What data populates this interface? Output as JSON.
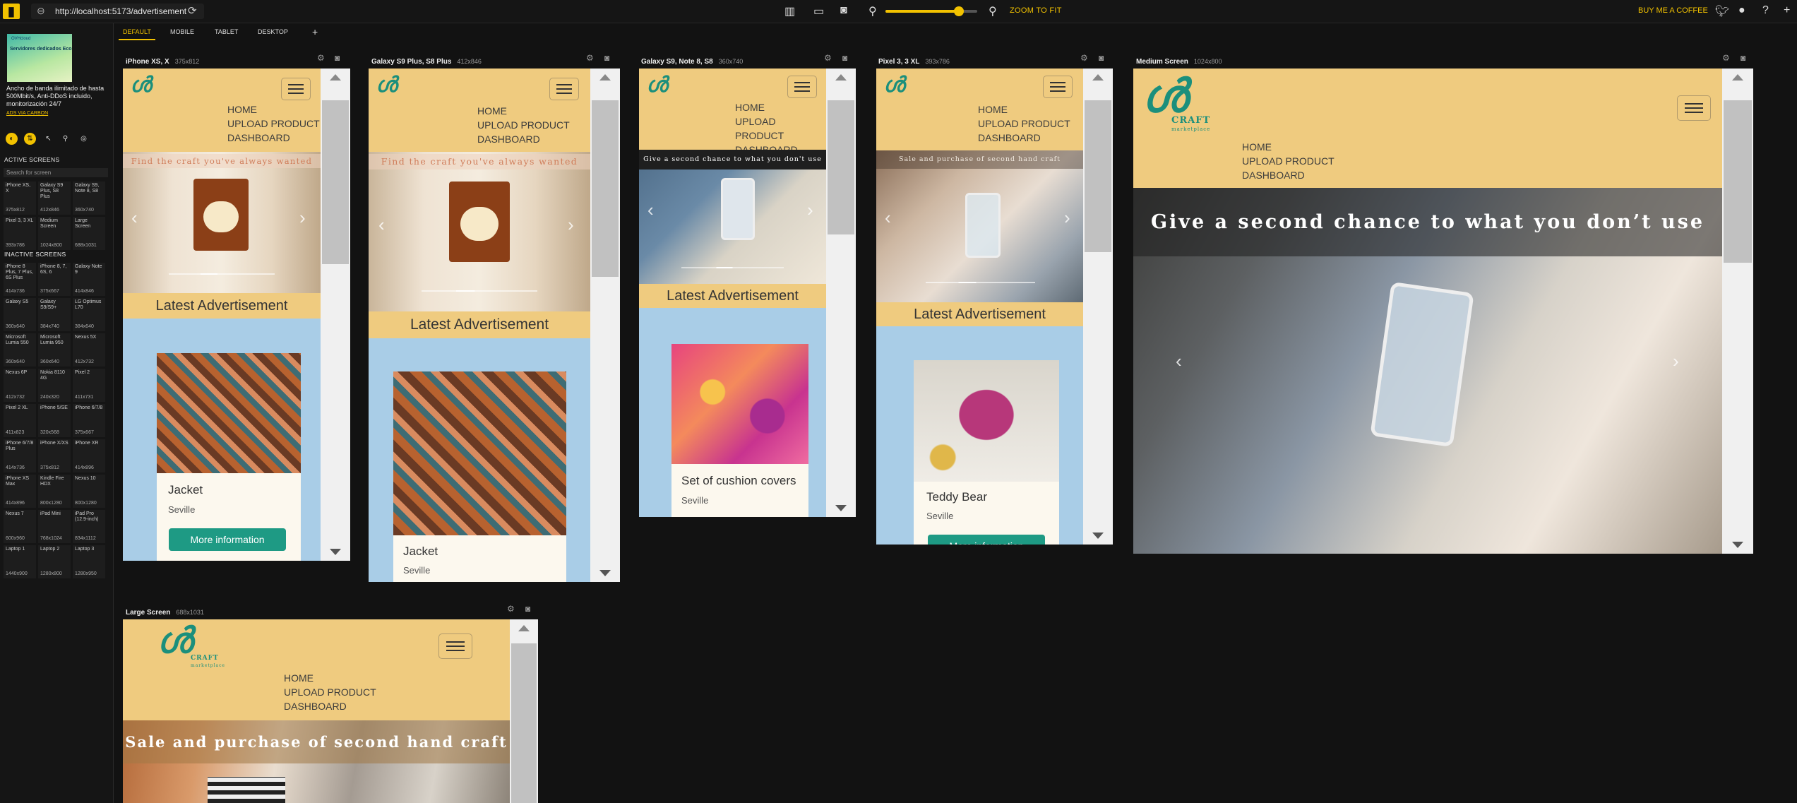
{
  "toolbar": {
    "url": "http://localhost:5173/advertisement",
    "zoom_level": 0.4,
    "zoom_to_fit": "ZOOM TO FIT",
    "buy_coffee": "BUY ME A COFFEE"
  },
  "tabs": [
    "DEFAULT",
    "MOBILE",
    "TABLET",
    "DESKTOP"
  ],
  "sidebar": {
    "ad_image_line1": "OVHcloud",
    "ad_image_line2": "Servidores dedicados Eco",
    "ad_text": "Ancho de banda ilimitado de hasta 500Mbit/s, Anti-DDoS incluido, monitorización 24/7",
    "ad_link": "ADS VIA CARBON",
    "active_heading": "ACTIVE SCREENS",
    "search_placeholder": "Search for screen",
    "inactive_heading": "INACTIVE SCREENS",
    "active_screens": [
      {
        "name": "iPhone XS, X",
        "size": "375x812"
      },
      {
        "name": "Galaxy S9 Plus, S8 Plus",
        "size": "412x846"
      },
      {
        "name": "Galaxy S9, Note 8, S8",
        "size": "360x740"
      },
      {
        "name": "Pixel 3, 3 XL",
        "size": "393x786"
      },
      {
        "name": "Medium Screen",
        "size": "1024x800"
      },
      {
        "name": "Large Screen",
        "size": "688x1031"
      }
    ],
    "inactive_screens": [
      {
        "name": "iPhone 8 Plus, 7 Plus, 6S Plus",
        "size": "414x736"
      },
      {
        "name": "iPhone 8, 7, 6S, 6",
        "size": "375x667"
      },
      {
        "name": "Galaxy Note 9",
        "size": "414x846"
      },
      {
        "name": "Galaxy S5",
        "size": "360x640"
      },
      {
        "name": "Galaxy S9/S9+",
        "size": "384x740"
      },
      {
        "name": "LG Optimus L70",
        "size": "384x640"
      },
      {
        "name": "Microsoft Lumia 550",
        "size": "360x640"
      },
      {
        "name": "Microsoft Lumia 950",
        "size": "360x640"
      },
      {
        "name": "Nexus 5X",
        "size": "412x732"
      },
      {
        "name": "Nexus 6P",
        "size": "412x732"
      },
      {
        "name": "Nokia 8110 4G",
        "size": "240x320"
      },
      {
        "name": "Pixel 2",
        "size": "411x731"
      },
      {
        "name": "Pixel 2 XL",
        "size": "411x823"
      },
      {
        "name": "iPhone 5/SE",
        "size": "320x568"
      },
      {
        "name": "iPhone 6/7/8",
        "size": "375x667"
      },
      {
        "name": "iPhone 6/7/8 Plus",
        "size": "414x736"
      },
      {
        "name": "iPhone X/XS",
        "size": "375x812"
      },
      {
        "name": "iPhone XR",
        "size": "414x896"
      },
      {
        "name": "iPhone XS Max",
        "size": "414x896"
      },
      {
        "name": "Kindle Fire HDX",
        "size": "800x1280"
      },
      {
        "name": "Nexus 10",
        "size": "800x1280"
      },
      {
        "name": "Nexus 7",
        "size": "600x960"
      },
      {
        "name": "iPad Mini",
        "size": "768x1024"
      },
      {
        "name": "iPad Pro (12.9-inch)",
        "size": "834x1112"
      },
      {
        "name": "Laptop 1",
        "size": "1440x900"
      },
      {
        "name": "Laptop 2",
        "size": "1280x800"
      },
      {
        "name": "Laptop 3",
        "size": "1280x950"
      }
    ]
  },
  "site": {
    "brand": "CRAFT",
    "brand_sub": "marketplace",
    "nav": [
      "HOME",
      "UPLOAD PRODUCT",
      "DASHBOARD"
    ],
    "latest": "Latest Advertisement",
    "more_info": "More information",
    "city": "Seville"
  },
  "devices": [
    {
      "name": "iPhone XS, X",
      "size": "375x812",
      "caption": "Find the craft you've always wanted",
      "card_title": "Jacket",
      "show_button": true
    },
    {
      "name": "Galaxy S9 Plus, S8 Plus",
      "size": "412x846",
      "caption": "Find the craft you've always wanted",
      "card_title": "Jacket",
      "show_button": false
    },
    {
      "name": "Galaxy S9, Note 8, S8",
      "size": "360x740",
      "caption": "Give a second chance to what you don't use",
      "card_title": "Set of cushion covers",
      "show_button": false
    },
    {
      "name": "Pixel 3, 3 XL",
      "size": "393x786",
      "caption": "Sale and purchase of second hand craft",
      "card_title": "Teddy Bear",
      "show_button": true
    },
    {
      "name": "Medium Screen",
      "size": "1024x800",
      "caption": "Give a second chance to what you don’t use"
    },
    {
      "name": "Large Screen",
      "size": "688x1031",
      "caption": "Sale and purchase of second hand craft"
    }
  ],
  "colors": {
    "accent": "#f2c200",
    "site_header": "#efcb7f",
    "site_body": "#a9cde7",
    "button": "#1e9a84"
  }
}
